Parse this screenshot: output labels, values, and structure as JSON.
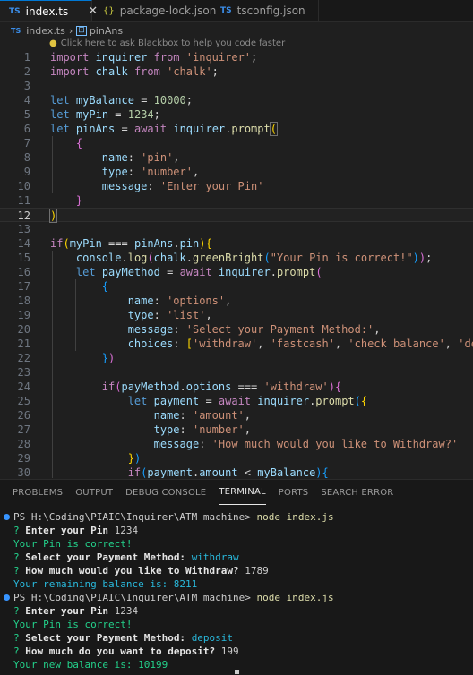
{
  "tabs": [
    {
      "label": "index.ts",
      "badge": "TS",
      "active": true
    },
    {
      "label": "package-lock.json",
      "badge": "{}",
      "active": false
    },
    {
      "label": "tsconfig.json",
      "badge": "TS",
      "active": false
    }
  ],
  "breadcrumb": {
    "file": "index.ts",
    "symbol": "pinAns"
  },
  "hint": "Click here to ask Blackbox to help you code faster",
  "editor": {
    "line_numbers": [
      "1",
      "2",
      "3",
      "4",
      "5",
      "6",
      "7",
      "8",
      "9",
      "10",
      "11",
      "12",
      "13",
      "14",
      "15",
      "16",
      "17",
      "18",
      "19",
      "20",
      "21",
      "22",
      "23",
      "24",
      "25",
      "26",
      "27",
      "28",
      "29",
      "30"
    ],
    "current_line": "12"
  },
  "panel_tabs": [
    "PROBLEMS",
    "OUTPUT",
    "DEBUG CONSOLE",
    "TERMINAL",
    "PORTS",
    "SEARCH ERROR"
  ],
  "terminal": {
    "run1": {
      "prompt": "PS H:\\Coding\\PIAIC\\Inquirer\\ATM machine>",
      "command": "node index.js",
      "q1": "Enter your Pin",
      "a1": "1234",
      "msg1": "Your Pin is correct!",
      "q2": "Select your Payment Method:",
      "a2": "withdraw",
      "q3": "How much would you like to Withdraw?",
      "a3": "1789",
      "result": "Your remaining balance is: 8211"
    },
    "run2": {
      "prompt": "PS H:\\Coding\\PIAIC\\Inquirer\\ATM machine>",
      "command": "node index.js",
      "q1": "Enter your Pin",
      "a1": "1234",
      "msg1": "Your Pin is correct!",
      "q2": "Select your Payment Method:",
      "a2": "deposit",
      "q3": "How much do you want to deposit?",
      "a3": "199",
      "result": "Your new balance is: 10199"
    }
  },
  "colors": {
    "accent": "#0078d4",
    "editor_bg": "#1f1f1f",
    "terminal_green": "#23d18b",
    "terminal_cyan": "#29b8db"
  }
}
